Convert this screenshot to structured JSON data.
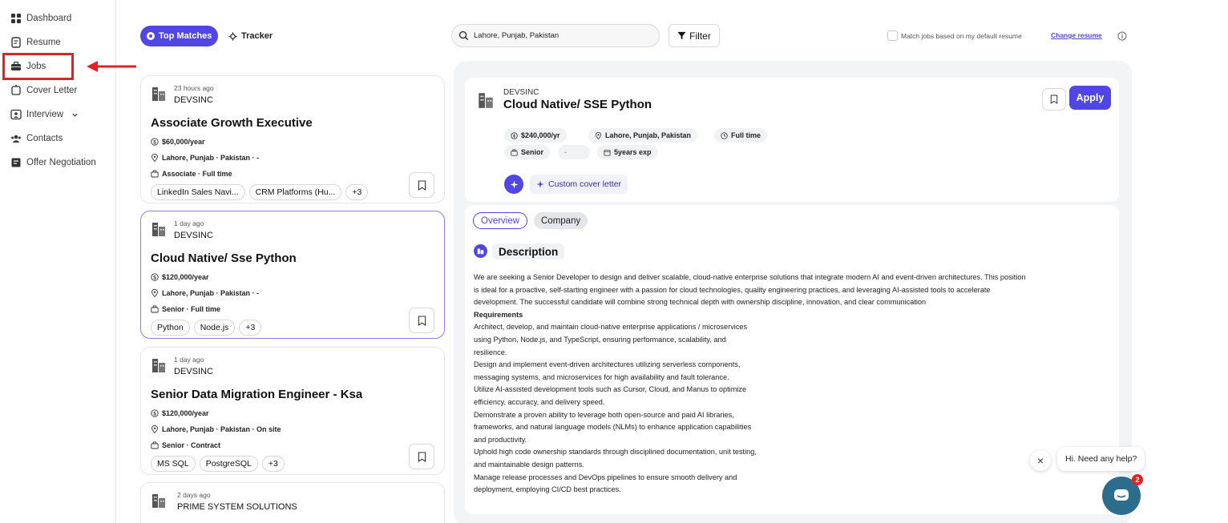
{
  "sidebar": {
    "items": [
      {
        "label": "Dashboard",
        "icon": "dashboard-icon"
      },
      {
        "label": "Resume",
        "icon": "resume-icon"
      },
      {
        "label": "Jobs",
        "icon": "briefcase-icon"
      },
      {
        "label": "Cover Letter",
        "icon": "cover-letter-icon"
      },
      {
        "label": "Interview",
        "icon": "interview-icon"
      },
      {
        "label": "Contacts",
        "icon": "contacts-icon"
      },
      {
        "label": "Offer Negotiation",
        "icon": "offer-icon"
      }
    ]
  },
  "toolbar": {
    "top_matches_label": "Top Matches",
    "tracker_label": "Tracker",
    "search_value": "Lahore, Punjab, Pakistan",
    "filter_label": "Filter",
    "match_label": "Match jobs based on my default resume",
    "change_resume_label": "Change resume"
  },
  "jobs": [
    {
      "age": "23 hours ago",
      "company": "DEVSINC",
      "title": "Associate Growth Executive",
      "salary": "$60,000/year",
      "location": "Lahore, Punjab · Pakistan · -",
      "level": "Associate · Full time",
      "tags": [
        "LinkedIn Sales Navi...",
        "CRM Platforms (Hu...",
        "+3"
      ]
    },
    {
      "age": "1 day ago",
      "company": "DEVSINC",
      "title": "Cloud Native/ Sse Python",
      "salary": "$120,000/year",
      "location": "Lahore, Punjab · Pakistan · -",
      "level": "Senior · Full time",
      "tags": [
        "Python",
        "Node.js",
        "+3"
      ]
    },
    {
      "age": "1 day ago",
      "company": "DEVSINC",
      "title": "Senior Data Migration Engineer - Ksa",
      "salary": "$120,000/year",
      "location": "Lahore, Punjab · Pakistan · On site",
      "level": "Senior · Contract",
      "tags": [
        "MS SQL",
        "PostgreSQL",
        "+3"
      ]
    },
    {
      "age": "2 days ago",
      "company": "PRIME SYSTEM SOLUTIONS"
    }
  ],
  "detail": {
    "company": "DEVSINC",
    "title": "Cloud Native/ SSE Python",
    "apply_label": "Apply",
    "salary": "$240,000/yr",
    "location": "Lahore, Punjab, Pakistan",
    "type": "Full time",
    "level": "Senior",
    "empty_chip": "-",
    "experience": "5years exp",
    "cover_letter_label": "Custom cover letter",
    "tab_overview": "Overview",
    "tab_company": "Company",
    "description_heading": "Description",
    "description_lines": [
      "We are seeking a Senior Developer to design and deliver scalable, cloud-native enterprise solutions that integrate modern AI and event-driven architectures. This position",
      "is ideal for a proactive, self-starting engineer with a passion for cloud technologies, quality engineering practices, and leveraging AI-assisted tools to accelerate",
      "development. The successful candidate will combine strong technical depth with ownership discipline, innovation, and clear communication"
    ],
    "requirements_heading": "Requirements",
    "requirements_lines": [
      "Architect, develop, and maintain cloud-native enterprise applications / microservices",
      "using Python, Node.js, and TypeScript, ensuring performance, scalability, and",
      "resilience.",
      "Design and implement event-driven architectures utilizing serverless components,",
      "messaging systems, and microservices for high availability and fault tolerance.",
      "Utilize AI-assisted development tools such as Cursor, Cloud, and Manus to optimize",
      "efficiency, accuracy, and delivery speed.",
      "Demonstrate a proven ability to leverage both open-source and paid AI libraries,",
      "frameworks, and natural language models (NLMs) to enhance application capabilities",
      "and productivity.",
      "Uphold high code ownership standards through disciplined documentation, unit testing,",
      "and maintainable design patterns.",
      "Manage release processes and DevOps pipelines to ensure smooth delivery and",
      "deployment, employing CI/CD best practices."
    ]
  },
  "chat": {
    "message": "Hi. Need any help?",
    "badge_count": "2",
    "close_label": "×"
  },
  "colors": {
    "accent": "#4f46e5",
    "highlight": "#e02424",
    "chat": "#2c6d8e"
  }
}
